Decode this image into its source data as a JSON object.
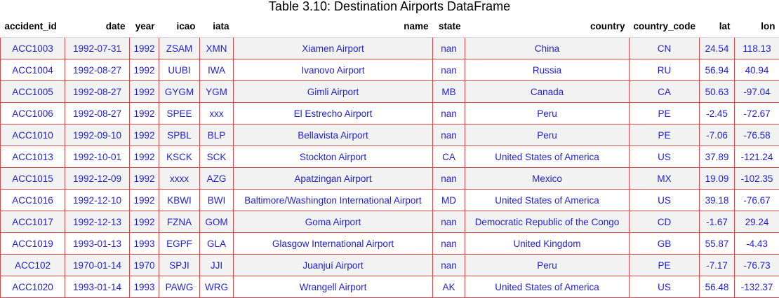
{
  "caption": "Table 3.10: Destination Airports DataFrame",
  "columns": [
    "accident_id",
    "date",
    "year",
    "icao",
    "iata",
    "name",
    "state",
    "country",
    "country_code",
    "lat",
    "lon"
  ],
  "rows": [
    [
      "ACC1003",
      "1992-07-31",
      "1992",
      "ZSAM",
      "XMN",
      "Xiamen Airport",
      "nan",
      "China",
      "CN",
      "24.54",
      "118.13"
    ],
    [
      "ACC1004",
      "1992-08-27",
      "1992",
      "UUBI",
      "IWA",
      "Ivanovo Airport",
      "nan",
      "Russia",
      "RU",
      "56.94",
      "40.94"
    ],
    [
      "ACC1005",
      "1992-08-27",
      "1992",
      "GYGM",
      "YGM",
      "Gimli Airport",
      "MB",
      "Canada",
      "CA",
      "50.63",
      "-97.04"
    ],
    [
      "ACC1006",
      "1992-08-27",
      "1992",
      "SPEE",
      "xxx",
      "El Estrecho Airport",
      "nan",
      "Peru",
      "PE",
      "-2.45",
      "-72.67"
    ],
    [
      "ACC1010",
      "1992-09-10",
      "1992",
      "SPBL",
      "BLP",
      "Bellavista Airport",
      "nan",
      "Peru",
      "PE",
      "-7.06",
      "-76.58"
    ],
    [
      "ACC1013",
      "1992-10-01",
      "1992",
      "KSCK",
      "SCK",
      "Stockton Airport",
      "CA",
      "United States of America",
      "US",
      "37.89",
      "-121.24"
    ],
    [
      "ACC1015",
      "1992-12-09",
      "1992",
      "xxxx",
      "AZG",
      "Apatzingan Airport",
      "nan",
      "Mexico",
      "MX",
      "19.09",
      "-102.35"
    ],
    [
      "ACC1016",
      "1992-12-10",
      "1992",
      "KBWI",
      "BWI",
      "Baltimore/Washington International Airport",
      "MD",
      "United States of America",
      "US",
      "39.18",
      "-76.67"
    ],
    [
      "ACC1017",
      "1992-12-13",
      "1992",
      "FZNA",
      "GOM",
      "Goma Airport",
      "nan",
      "Democratic Republic of the Congo",
      "CD",
      "-1.67",
      "29.24"
    ],
    [
      "ACC1019",
      "1993-01-13",
      "1993",
      "EGPF",
      "GLA",
      "Glasgow International Airport",
      "nan",
      "United Kingdom",
      "GB",
      "55.87",
      "-4.43"
    ],
    [
      "ACC102",
      "1970-01-14",
      "1970",
      "SPJI",
      "JJI",
      "Juanjuí Airport",
      "nan",
      "Peru",
      "PE",
      "-7.17",
      "-76.73"
    ],
    [
      "ACC1020",
      "1993-01-14",
      "1993",
      "PAWG",
      "WRG",
      "Wrangell Airport",
      "AK",
      "United States of America",
      "US",
      "56.48",
      "-132.37"
    ]
  ],
  "colors": {
    "cell_text": "#1f1fd6",
    "cell_border": "#d9484b",
    "stripe": "#f2f2f2"
  }
}
